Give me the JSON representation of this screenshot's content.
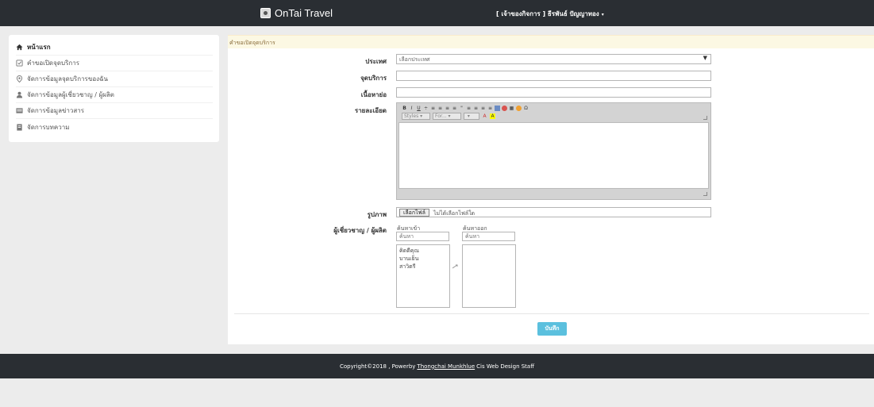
{
  "header": {
    "brand": "OnTai Travel",
    "user": "[ เจ้าของกิจการ ] ธีรพันธ์ ปัญญาทอง"
  },
  "sidebar": {
    "items": [
      {
        "label": "หน้าแรก",
        "icon": "home-icon"
      },
      {
        "label": "คำขอเปิดจุดบริการ",
        "icon": "check-square-icon"
      },
      {
        "label": "จัดการข้อมูลจุดบริการของฉัน",
        "icon": "map-marker-icon"
      },
      {
        "label": "จัดการข้อมูลผู้เชี่ยวชาญ / ผู้ผลิต",
        "icon": "user-icon"
      },
      {
        "label": "จัดการข้อมูลข่าวสาร",
        "icon": "news-icon"
      },
      {
        "label": "จัดการบทความ",
        "icon": "document-icon"
      }
    ]
  },
  "main": {
    "breadcrumb": "คำขอเปิดจุดบริการ",
    "form": {
      "country_label": "ประเทศ",
      "country_value": "เลือกประเทศ",
      "service_label": "จุดบริการ",
      "summary_label": "เนื้อหาย่อ",
      "detail_label": "รายละเอียด",
      "editor_styles": "Styles",
      "editor_format": "For...",
      "image_label": "รูปภาพ",
      "file_button": "เลือกไฟล์",
      "file_status": "ไม่ได้เลือกไฟล์ใด",
      "experts_label": "ผู้เชี่ยวชาญ / ผู้ผลิต",
      "search_in_label": "ค้นหาเข้า",
      "search_out_label": "ค้นหาออก",
      "search_placeholder": "ค้นหา",
      "available": [
        "คิดดีคุณ",
        "บานเย็น",
        "สาวิตรี"
      ],
      "save_button": "บันทึก"
    }
  },
  "footer": {
    "prefix": "Copyright©2018 , Powerby",
    "link": "Thongchai Munkhlue",
    "suffix": "Cis Web Design Staff"
  }
}
